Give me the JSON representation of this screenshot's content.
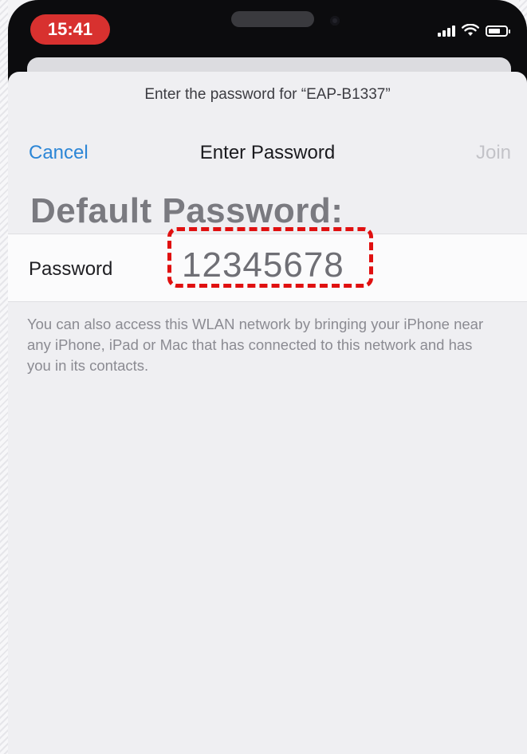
{
  "status_bar": {
    "time": "15:41",
    "icons": [
      "signal-icon",
      "wifi-icon",
      "battery-icon"
    ]
  },
  "dialog": {
    "prompt": "Enter the password for “EAP-B1337”",
    "cancel_label": "Cancel",
    "title": "Enter Password",
    "join_label": "Join"
  },
  "overlay": {
    "heading": "Default Password:"
  },
  "password_field": {
    "label": "Password",
    "value": "12345678"
  },
  "info": {
    "text": "You can also access this WLAN network by bringing your iPhone near any iPhone, iPad or Mac that has connected to this network and has you in its contacts."
  },
  "colors": {
    "accent": "#2c86d6",
    "time_pill": "#d8312f",
    "highlight": "#e01010",
    "disabled": "#c3c3c8"
  }
}
